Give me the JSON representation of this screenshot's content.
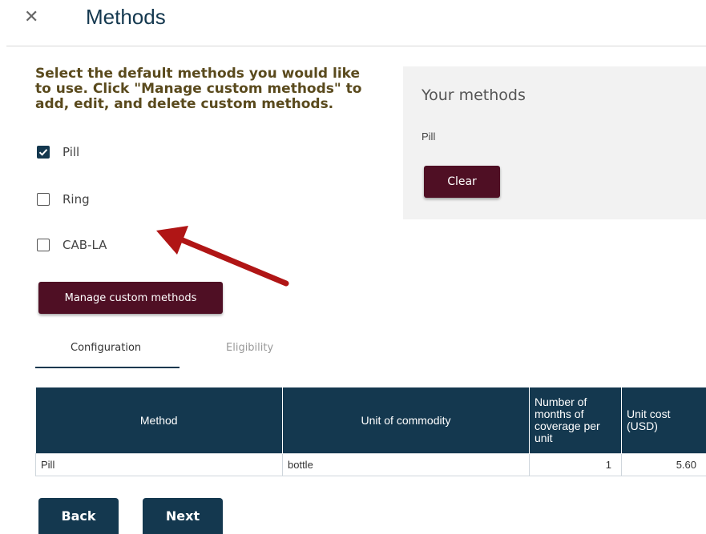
{
  "header": {
    "close_icon": "close-icon",
    "title": "Methods"
  },
  "instructions": "Select the default methods you would like to use. Click \"Manage custom methods\" to add, edit, and delete custom methods.",
  "methods": [
    {
      "label": "Pill",
      "checked": true
    },
    {
      "label": "Ring",
      "checked": false
    },
    {
      "label": "CAB-LA",
      "checked": false
    }
  ],
  "your_methods": {
    "title": "Your methods",
    "items": [
      "Pill"
    ],
    "clear_label": "Clear"
  },
  "manage_button": "Manage custom methods",
  "tabs": [
    {
      "label": "Configuration",
      "active": true
    },
    {
      "label": "Eligibility",
      "active": false
    }
  ],
  "table": {
    "headers": [
      "Method",
      "Unit of commodity",
      "Number of months of coverage per unit",
      "Unit cost (USD)"
    ],
    "rows": [
      [
        "Pill",
        "bottle",
        "1",
        "5.60"
      ]
    ]
  },
  "footer": {
    "back_label": "Back",
    "next_label": "Next"
  },
  "annotation": {
    "arrow_color": "#b01515"
  },
  "colors": {
    "primary": "#14384f",
    "accent": "#4f0f24",
    "instructions_text": "#5a4a1d"
  }
}
